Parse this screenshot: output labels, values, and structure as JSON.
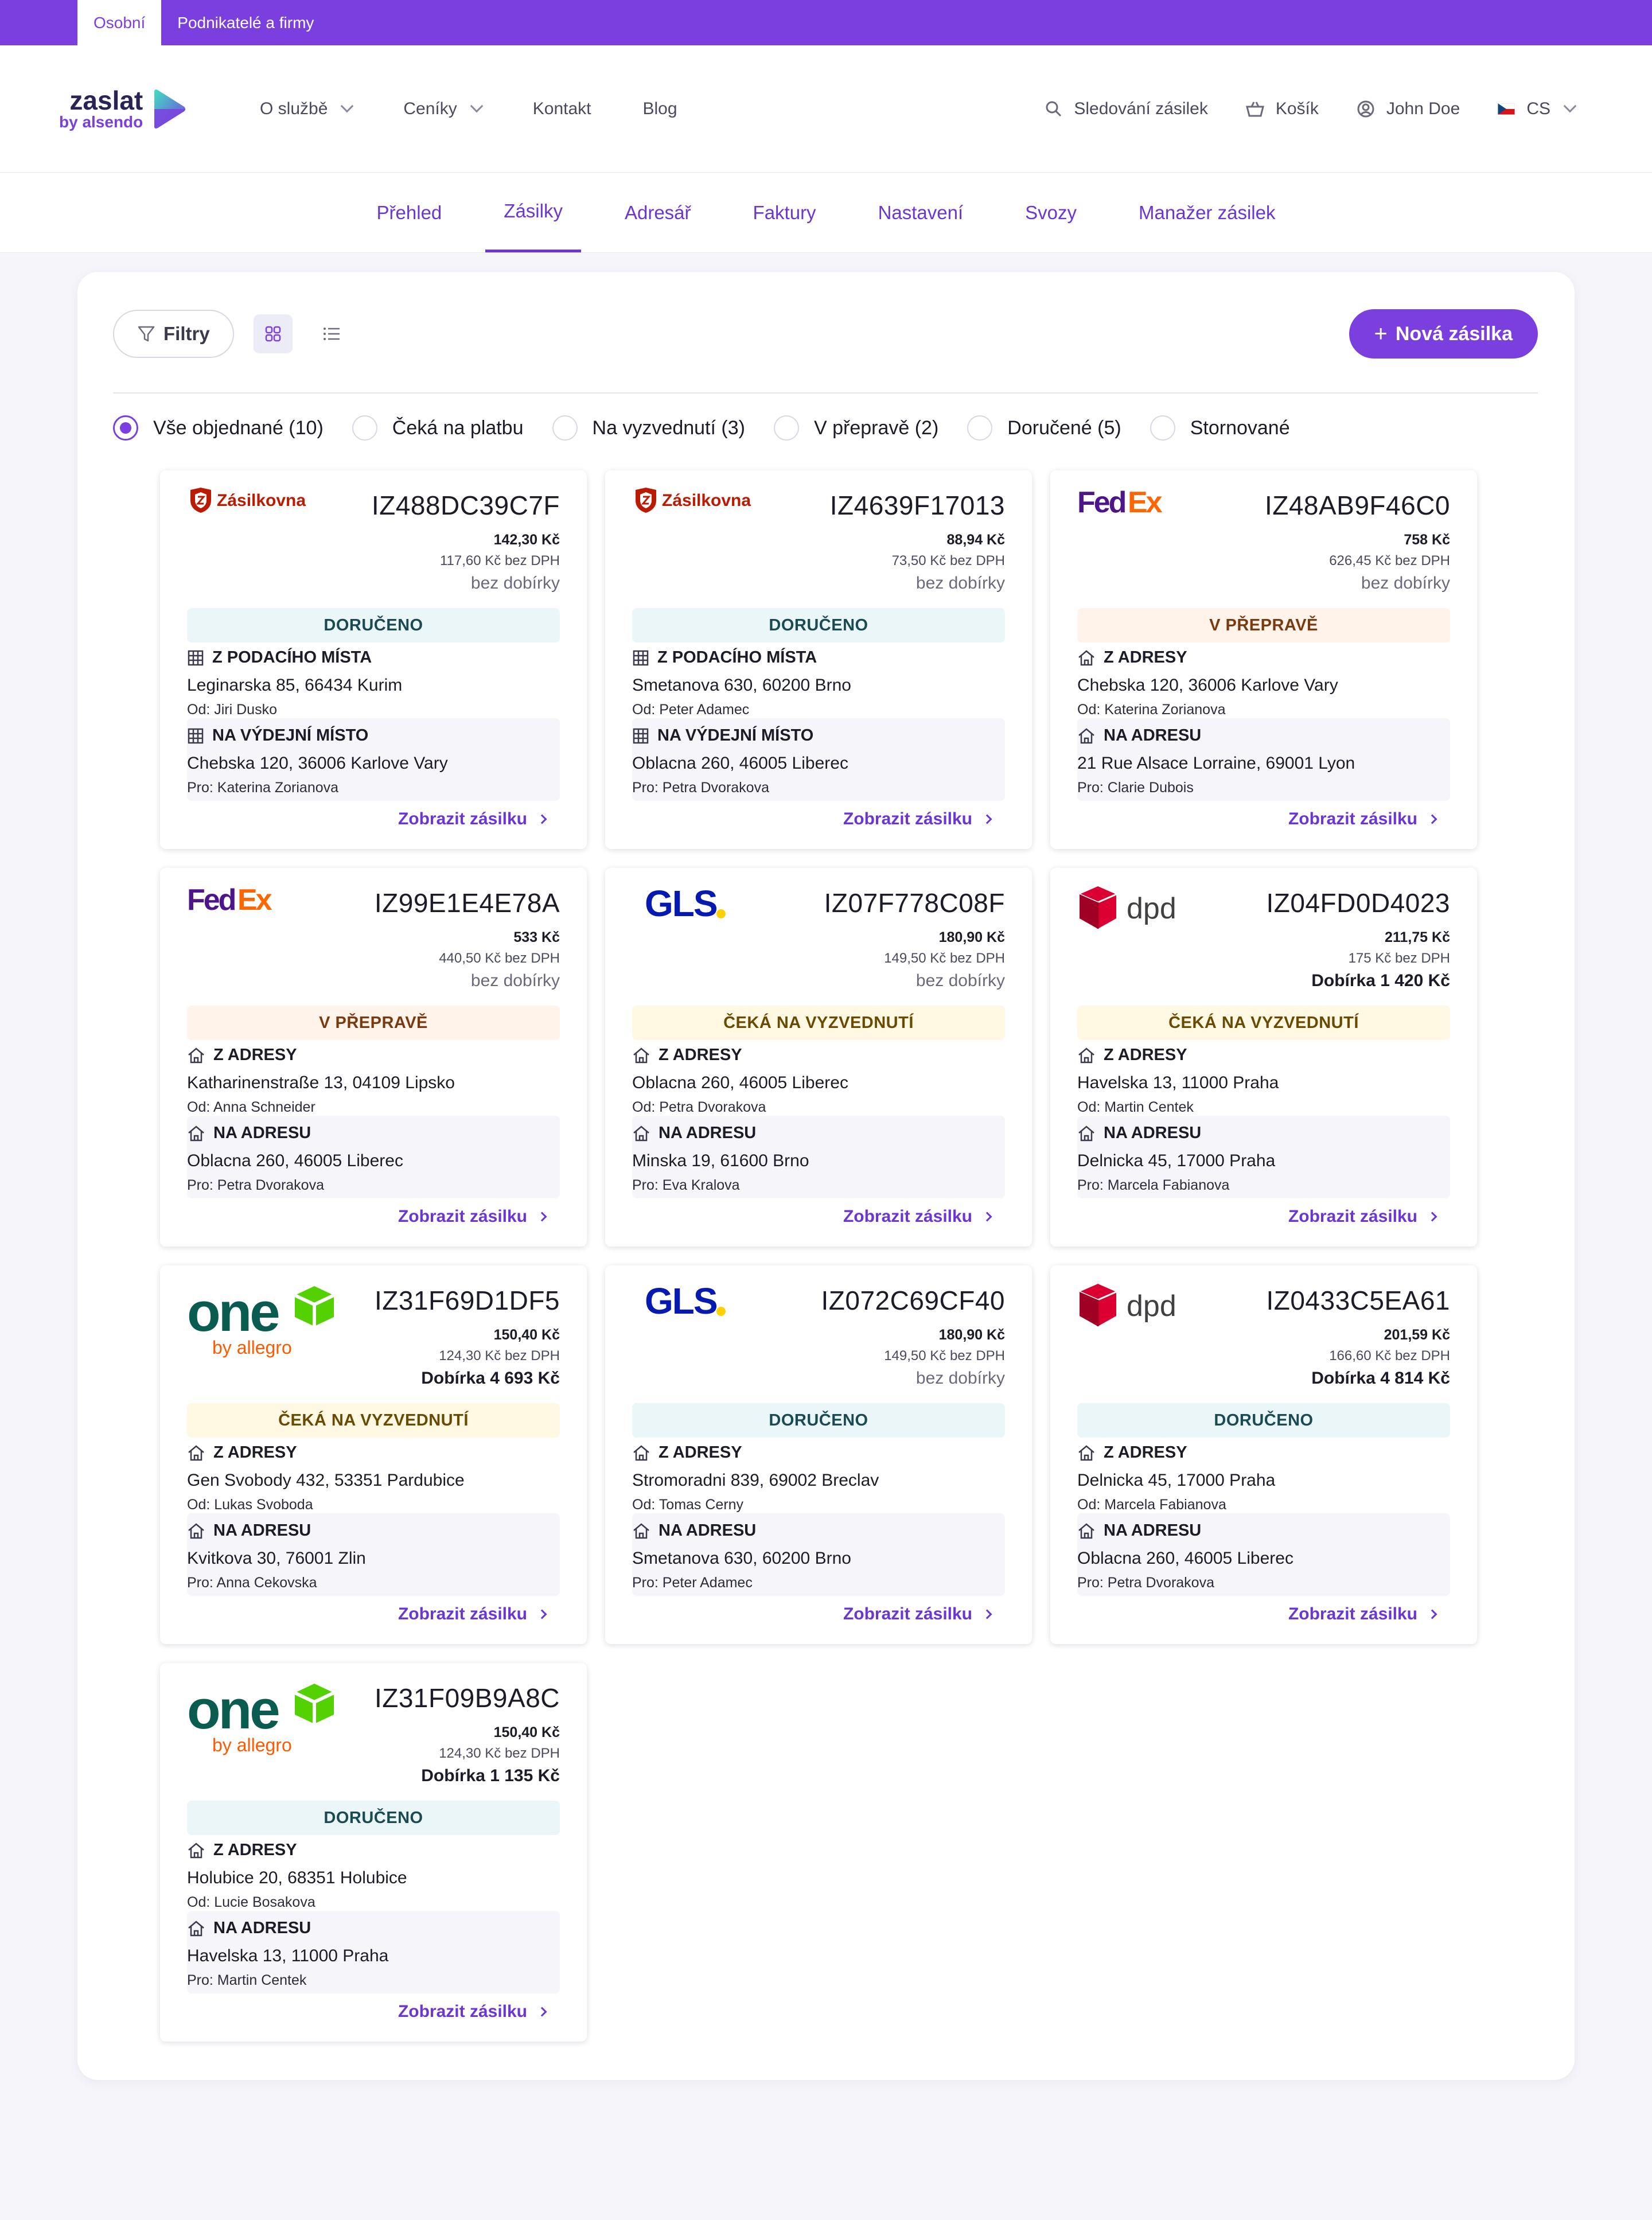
{
  "topbar": {
    "personal": "Osobní",
    "business": "Podnikatelé a firmy"
  },
  "logo": {
    "line1": "zaslat",
    "line2": "by alsendo"
  },
  "mainnav": {
    "about": "O službě",
    "pricing": "Ceníky",
    "contact": "Kontakt",
    "blog": "Blog"
  },
  "rightnav": {
    "tracking": "Sledování zásilek",
    "cart": "Košík",
    "user": "John Doe",
    "lang": "CS"
  },
  "subnav": [
    "Přehled",
    "Zásilky",
    "Adresář",
    "Faktury",
    "Nastavení",
    "Svozy",
    "Manažer zásilek"
  ],
  "toolbar": {
    "filters": "Filtry",
    "new_shipment": "Nová zásilka"
  },
  "status_filters": [
    "Vše objednané (10)",
    "Čeká na platbu",
    "Na vyzvednutí (3)",
    "V přepravě (2)",
    "Doručené (5)",
    "Stornované"
  ],
  "link_label": "Zobrazit zásilku",
  "cards": [
    {
      "carrier": "Zásilkovna",
      "code": "IZ488DC39C7F",
      "price": "142,30 Kč",
      "netto": "117,60 Kč bez DPH",
      "cod": "bez dobírky",
      "status": "DORUČENO",
      "from_head": "Z PODACÍHO MÍSTA",
      "from_addr": "Leginarska 85, 66434 Kurim",
      "from_who": "Od: Jiri Dusko",
      "to_head": "NA VÝDEJNÍ MÍSTO",
      "to_addr": "Chebska 120, 36006 Karlove Vary",
      "to_who": "Pro: Katerina Zorianova"
    },
    {
      "carrier": "Zásilkovna",
      "code": "IZ4639F17013",
      "price": "88,94 Kč",
      "netto": "73,50 Kč bez DPH",
      "cod": "bez dobírky",
      "status": "DORUČENO",
      "from_head": "Z PODACÍHO MÍSTA",
      "from_addr": "Smetanova 630, 60200 Brno",
      "from_who": "Od: Peter Adamec",
      "to_head": "NA VÝDEJNÍ MÍSTO",
      "to_addr": "Oblacna 260, 46005 Liberec",
      "to_who": "Pro: Petra Dvorakova"
    },
    {
      "carrier": "FedEx",
      "code": "IZ48AB9F46C0",
      "price": "758 Kč",
      "netto": "626,45 Kč bez DPH",
      "cod": "bez dobírky",
      "status": "V PŘEPRAVĚ",
      "from_head": "Z ADRESY",
      "from_addr": "Chebska 120, 36006 Karlove Vary",
      "from_who": "Od: Katerina Zorianova",
      "to_head": "NA ADRESU",
      "to_addr": "21 Rue Alsace Lorraine, 69001 Lyon",
      "to_who": "Pro: Clarie Dubois"
    },
    {
      "carrier": "FedEx",
      "code": "IZ99E1E4E78A",
      "price": "533 Kč",
      "netto": "440,50 Kč bez DPH",
      "cod": "bez dobírky",
      "status": "V PŘEPRAVĚ",
      "from_head": "Z ADRESY",
      "from_addr": "Katharinenstraße 13, 04109 Lipsko",
      "from_who": "Od: Anna Schneider",
      "to_head": "NA ADRESU",
      "to_addr": "Oblacna 260, 46005 Liberec",
      "to_who": "Pro: Petra Dvorakova"
    },
    {
      "carrier": "GLS",
      "code": "IZ07F778C08F",
      "price": "180,90 Kč",
      "netto": "149,50 Kč bez DPH",
      "cod": "bez dobírky",
      "status": "ČEKÁ NA VYZVEDNUTÍ",
      "from_head": "Z ADRESY",
      "from_addr": "Oblacna 260, 46005 Liberec",
      "from_who": "Od: Petra Dvorakova",
      "to_head": "NA ADRESU",
      "to_addr": "Minska 19, 61600 Brno",
      "to_who": "Pro: Eva Kralova"
    },
    {
      "carrier": "dpd",
      "code": "IZ04FD0D4023",
      "price": "211,75 Kč",
      "netto": "175 Kč bez DPH",
      "cod": "Dobírka 1 420 Kč",
      "status": "ČEKÁ NA VYZVEDNUTÍ",
      "from_head": "Z ADRESY",
      "from_addr": "Havelska 13, 11000 Praha",
      "from_who": "Od: Martin Centek",
      "to_head": "NA ADRESU",
      "to_addr": "Delnicka 45, 17000 Praha",
      "to_who": "Pro: Marcela Fabianova"
    },
    {
      "carrier": "one",
      "carrier_sub": "by allegro",
      "code": "IZ31F69D1DF5",
      "price": "150,40 Kč",
      "netto": "124,30 Kč bez DPH",
      "cod": "Dobírka 4 693 Kč",
      "status": "ČEKÁ NA VYZVEDNUTÍ",
      "from_head": "Z ADRESY",
      "from_addr": "Gen Svobody 432, 53351 Pardubice",
      "from_who": "Od: Lukas Svoboda",
      "to_head": "NA ADRESU",
      "to_addr": "Kvitkova 30, 76001 Zlin",
      "to_who": "Pro: Anna Cekovska"
    },
    {
      "carrier": "GLS",
      "code": "IZ072C69CF40",
      "price": "180,90 Kč",
      "netto": "149,50 Kč bez DPH",
      "cod": "bez dobírky",
      "status": "DORUČENO",
      "from_head": "Z ADRESY",
      "from_addr": "Stromoradni 839, 69002 Breclav",
      "from_who": "Od: Tomas Cerny",
      "to_head": "NA ADRESU",
      "to_addr": "Smetanova 630, 60200 Brno",
      "to_who": "Pro: Peter Adamec"
    },
    {
      "carrier": "dpd",
      "code": "IZ0433C5EA61",
      "price": "201,59 Kč",
      "netto": "166,60 Kč bez DPH",
      "cod": "Dobírka 4 814 Kč",
      "status": "DORUČENO",
      "from_head": "Z ADRESY",
      "from_addr": "Delnicka 45, 17000 Praha",
      "from_who": "Od: Marcela Fabianova",
      "to_head": "NA ADRESU",
      "to_addr": "Oblacna 260, 46005 Liberec",
      "to_who": "Pro: Petra Dvorakova"
    },
    {
      "carrier": "one",
      "carrier_sub": "by allegro",
      "code": "IZ31F09B9A8C",
      "price": "150,40 Kč",
      "netto": "124,30 Kč bez DPH",
      "cod": "Dobírka 1 135 Kč",
      "status": "DORUČENO",
      "from_head": "Z ADRESY",
      "from_addr": "Holubice 20, 68351 Holubice",
      "from_who": "Od: Lucie Bosakova",
      "to_head": "NA ADRESU",
      "to_addr": "Havelska 13, 11000 Praha",
      "to_who": "Pro: Martin Centek"
    }
  ],
  "colors": {
    "brand": "#7b3fe0",
    "link": "#6a36d6",
    "delivered_bg": "#eaf6f8",
    "transit_bg": "#fff3ea",
    "waiting_bg": "#fff9e4"
  }
}
